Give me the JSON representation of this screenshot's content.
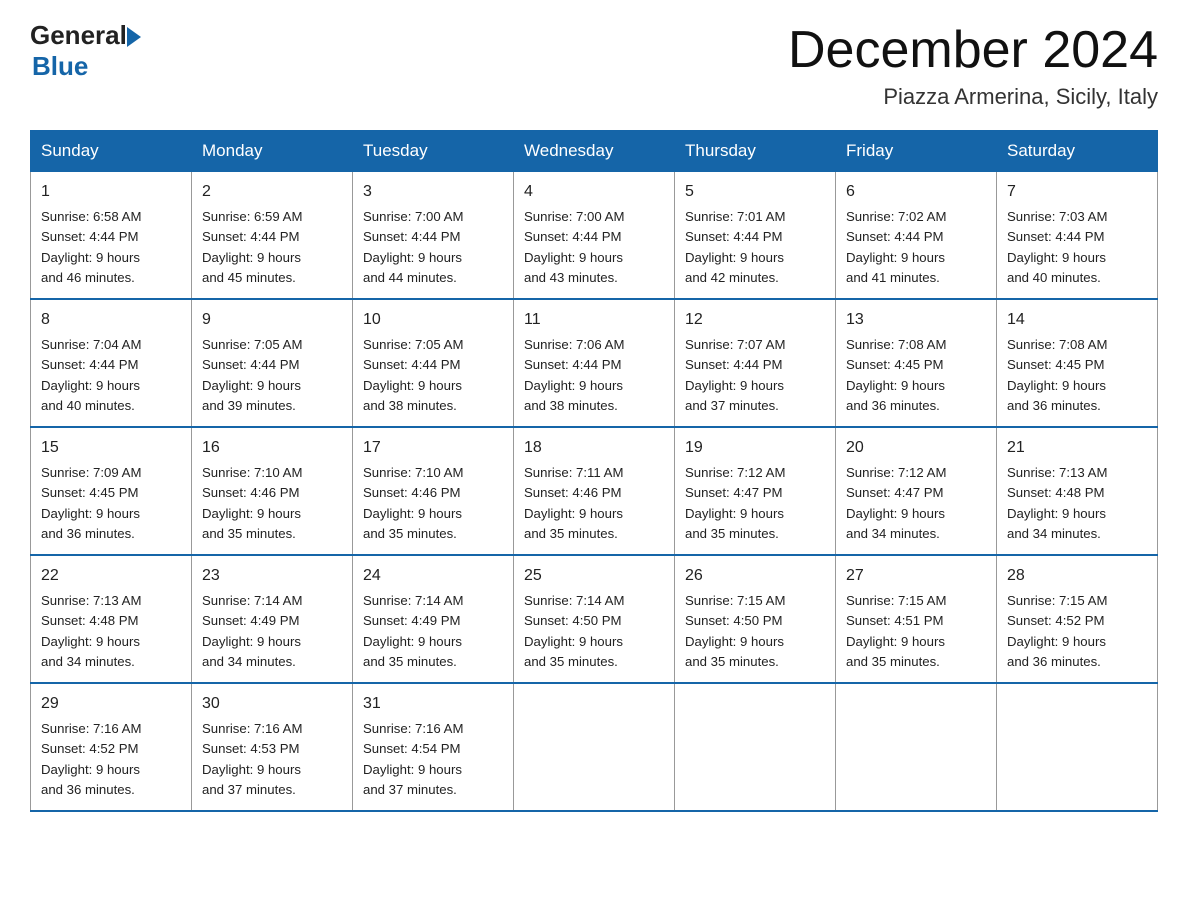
{
  "header": {
    "logo_general": "General",
    "logo_blue": "Blue",
    "month_year": "December 2024",
    "location": "Piazza Armerina, Sicily, Italy"
  },
  "days_of_week": [
    "Sunday",
    "Monday",
    "Tuesday",
    "Wednesday",
    "Thursday",
    "Friday",
    "Saturday"
  ],
  "weeks": [
    [
      {
        "day": "1",
        "sunrise": "6:58 AM",
        "sunset": "4:44 PM",
        "daylight": "9 hours and 46 minutes."
      },
      {
        "day": "2",
        "sunrise": "6:59 AM",
        "sunset": "4:44 PM",
        "daylight": "9 hours and 45 minutes."
      },
      {
        "day": "3",
        "sunrise": "7:00 AM",
        "sunset": "4:44 PM",
        "daylight": "9 hours and 44 minutes."
      },
      {
        "day": "4",
        "sunrise": "7:00 AM",
        "sunset": "4:44 PM",
        "daylight": "9 hours and 43 minutes."
      },
      {
        "day": "5",
        "sunrise": "7:01 AM",
        "sunset": "4:44 PM",
        "daylight": "9 hours and 42 minutes."
      },
      {
        "day": "6",
        "sunrise": "7:02 AM",
        "sunset": "4:44 PM",
        "daylight": "9 hours and 41 minutes."
      },
      {
        "day": "7",
        "sunrise": "7:03 AM",
        "sunset": "4:44 PM",
        "daylight": "9 hours and 40 minutes."
      }
    ],
    [
      {
        "day": "8",
        "sunrise": "7:04 AM",
        "sunset": "4:44 PM",
        "daylight": "9 hours and 40 minutes."
      },
      {
        "day": "9",
        "sunrise": "7:05 AM",
        "sunset": "4:44 PM",
        "daylight": "9 hours and 39 minutes."
      },
      {
        "day": "10",
        "sunrise": "7:05 AM",
        "sunset": "4:44 PM",
        "daylight": "9 hours and 38 minutes."
      },
      {
        "day": "11",
        "sunrise": "7:06 AM",
        "sunset": "4:44 PM",
        "daylight": "9 hours and 38 minutes."
      },
      {
        "day": "12",
        "sunrise": "7:07 AM",
        "sunset": "4:44 PM",
        "daylight": "9 hours and 37 minutes."
      },
      {
        "day": "13",
        "sunrise": "7:08 AM",
        "sunset": "4:45 PM",
        "daylight": "9 hours and 36 minutes."
      },
      {
        "day": "14",
        "sunrise": "7:08 AM",
        "sunset": "4:45 PM",
        "daylight": "9 hours and 36 minutes."
      }
    ],
    [
      {
        "day": "15",
        "sunrise": "7:09 AM",
        "sunset": "4:45 PM",
        "daylight": "9 hours and 36 minutes."
      },
      {
        "day": "16",
        "sunrise": "7:10 AM",
        "sunset": "4:46 PM",
        "daylight": "9 hours and 35 minutes."
      },
      {
        "day": "17",
        "sunrise": "7:10 AM",
        "sunset": "4:46 PM",
        "daylight": "9 hours and 35 minutes."
      },
      {
        "day": "18",
        "sunrise": "7:11 AM",
        "sunset": "4:46 PM",
        "daylight": "9 hours and 35 minutes."
      },
      {
        "day": "19",
        "sunrise": "7:12 AM",
        "sunset": "4:47 PM",
        "daylight": "9 hours and 35 minutes."
      },
      {
        "day": "20",
        "sunrise": "7:12 AM",
        "sunset": "4:47 PM",
        "daylight": "9 hours and 34 minutes."
      },
      {
        "day": "21",
        "sunrise": "7:13 AM",
        "sunset": "4:48 PM",
        "daylight": "9 hours and 34 minutes."
      }
    ],
    [
      {
        "day": "22",
        "sunrise": "7:13 AM",
        "sunset": "4:48 PM",
        "daylight": "9 hours and 34 minutes."
      },
      {
        "day": "23",
        "sunrise": "7:14 AM",
        "sunset": "4:49 PM",
        "daylight": "9 hours and 34 minutes."
      },
      {
        "day": "24",
        "sunrise": "7:14 AM",
        "sunset": "4:49 PM",
        "daylight": "9 hours and 35 minutes."
      },
      {
        "day": "25",
        "sunrise": "7:14 AM",
        "sunset": "4:50 PM",
        "daylight": "9 hours and 35 minutes."
      },
      {
        "day": "26",
        "sunrise": "7:15 AM",
        "sunset": "4:50 PM",
        "daylight": "9 hours and 35 minutes."
      },
      {
        "day": "27",
        "sunrise": "7:15 AM",
        "sunset": "4:51 PM",
        "daylight": "9 hours and 35 minutes."
      },
      {
        "day": "28",
        "sunrise": "7:15 AM",
        "sunset": "4:52 PM",
        "daylight": "9 hours and 36 minutes."
      }
    ],
    [
      {
        "day": "29",
        "sunrise": "7:16 AM",
        "sunset": "4:52 PM",
        "daylight": "9 hours and 36 minutes."
      },
      {
        "day": "30",
        "sunrise": "7:16 AM",
        "sunset": "4:53 PM",
        "daylight": "9 hours and 37 minutes."
      },
      {
        "day": "31",
        "sunrise": "7:16 AM",
        "sunset": "4:54 PM",
        "daylight": "9 hours and 37 minutes."
      },
      null,
      null,
      null,
      null
    ]
  ],
  "labels": {
    "sunrise": "Sunrise:",
    "sunset": "Sunset:",
    "daylight": "Daylight:"
  }
}
